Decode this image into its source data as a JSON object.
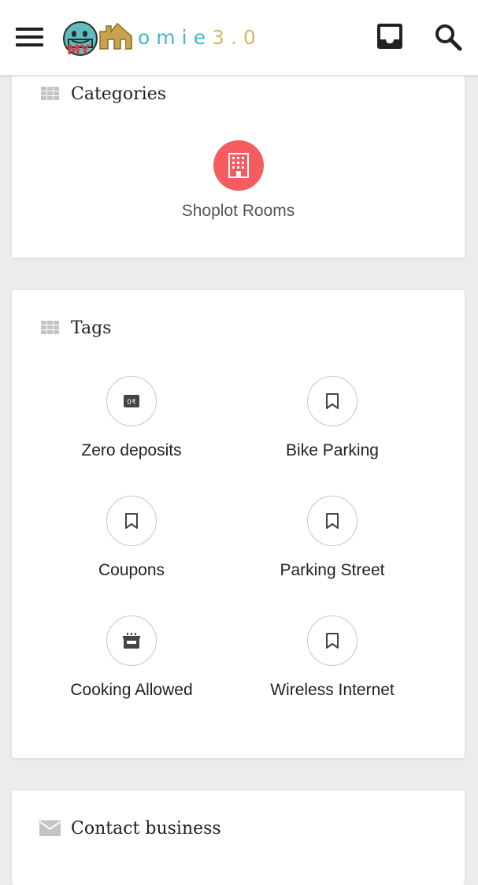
{
  "header": {
    "logo": {
      "mascot_text": "MY",
      "text_main": "omie",
      "text_version": "3.0"
    },
    "icons": {
      "menu": "hamburger-menu-icon",
      "inbox": "inbox-icon",
      "search": "search-icon"
    }
  },
  "categories": {
    "title": "Categories",
    "items": [
      {
        "label": "Shoplot Rooms",
        "icon": "building-icon",
        "color": "#f55c5f"
      }
    ]
  },
  "tags": {
    "title": "Tags",
    "items": [
      {
        "label": "Zero deposits",
        "icon": "zero-deposit-icon"
      },
      {
        "label": "Bike Parking",
        "icon": "bookmark-icon"
      },
      {
        "label": "Coupons",
        "icon": "bookmark-icon"
      },
      {
        "label": "Parking Street",
        "icon": "bookmark-icon"
      },
      {
        "label": "Cooking Allowed",
        "icon": "cooking-pot-icon"
      },
      {
        "label": "Wireless Internet",
        "icon": "bookmark-icon"
      }
    ]
  },
  "contact": {
    "title": "Contact business",
    "icon": "mail-icon"
  },
  "colors": {
    "background": "#ececec",
    "card": "#ffffff",
    "category_accent": "#f55c5f",
    "logo_teal": "#48b7c5",
    "logo_gold": "#d7b66a"
  }
}
